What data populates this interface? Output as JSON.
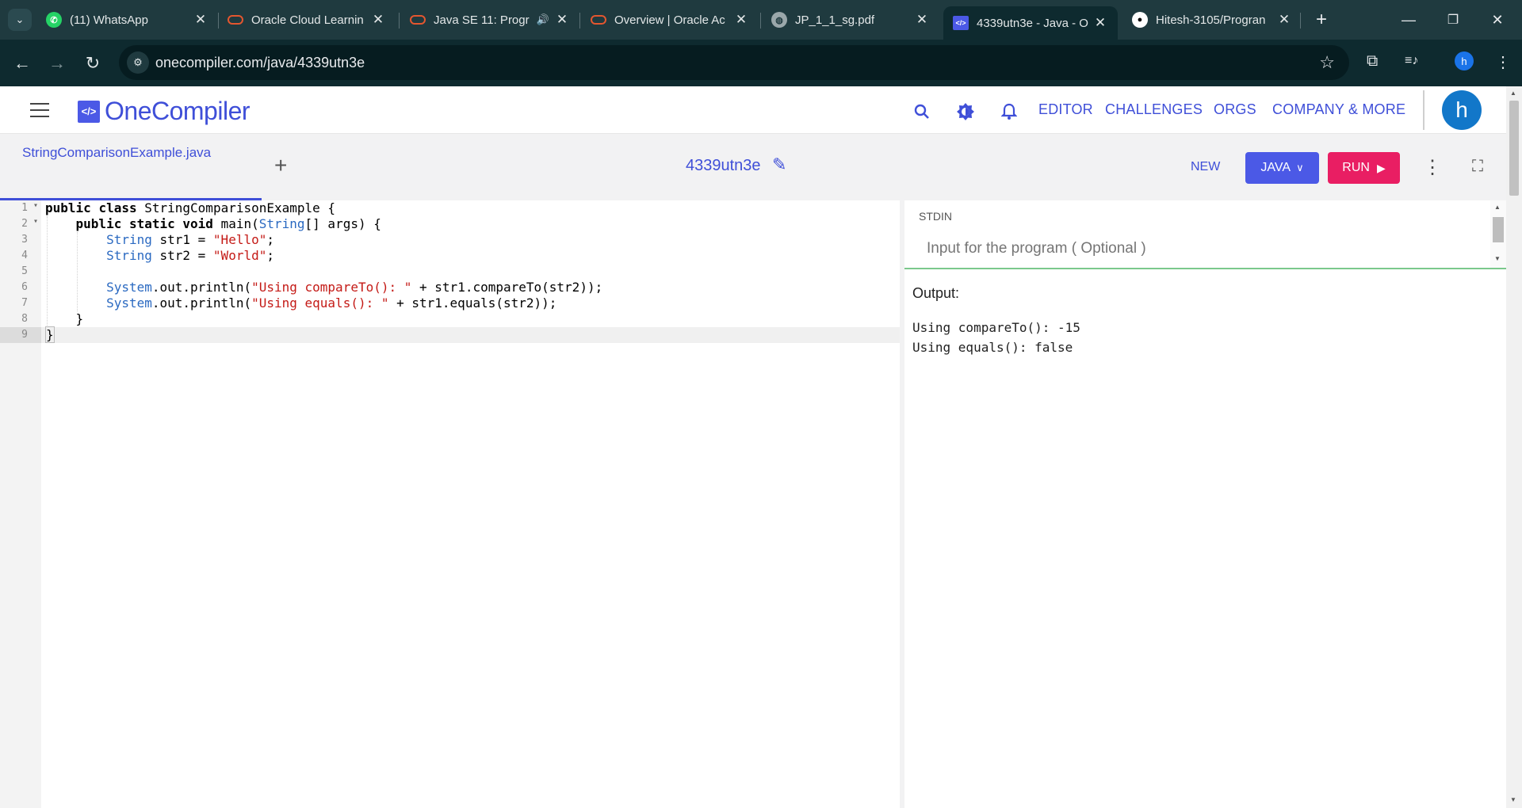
{
  "browser": {
    "tabs": [
      {
        "title": "(11) WhatsApp",
        "icon": "whatsapp-icon",
        "active": false
      },
      {
        "title": "Oracle Cloud Learnin",
        "icon": "oracle-icon",
        "active": false
      },
      {
        "title": "Java SE 11: Progr",
        "icon": "oracle-icon",
        "active": false,
        "audio": true
      },
      {
        "title": "Overview | Oracle Ac",
        "icon": "oracle-icon",
        "active": false
      },
      {
        "title": "JP_1_1_sg.pdf",
        "icon": "globe-icon",
        "active": false
      },
      {
        "title": "4339utn3e - Java - O",
        "icon": "onecompiler-icon",
        "active": true
      },
      {
        "title": "Hitesh-3105/Progran",
        "icon": "github-icon",
        "active": false
      }
    ],
    "url": "onecompiler.com/java/4339utn3e",
    "profile_initial": "h"
  },
  "header": {
    "logo_mark": "</>",
    "logo_text": "OneCompiler",
    "nav": [
      "EDITOR",
      "CHALLENGES",
      "ORGS",
      "COMPANY & MORE"
    ],
    "avatar_initial": "h"
  },
  "editor_bar": {
    "file_name": "StringComparisonExample.java",
    "code_id": "4339utn3e",
    "new_label": "NEW",
    "language_label": "JAVA",
    "run_label": "RUN"
  },
  "code": {
    "line_numbers": [
      "1",
      "2",
      "3",
      "4",
      "5",
      "6",
      "7",
      "8",
      "9"
    ],
    "active_line": 9
  },
  "stdin": {
    "label": "STDIN",
    "placeholder": "Input for the program ( Optional )"
  },
  "output": {
    "label": "Output:",
    "lines": [
      "Using compareTo(): -15",
      "Using equals(): false"
    ]
  }
}
